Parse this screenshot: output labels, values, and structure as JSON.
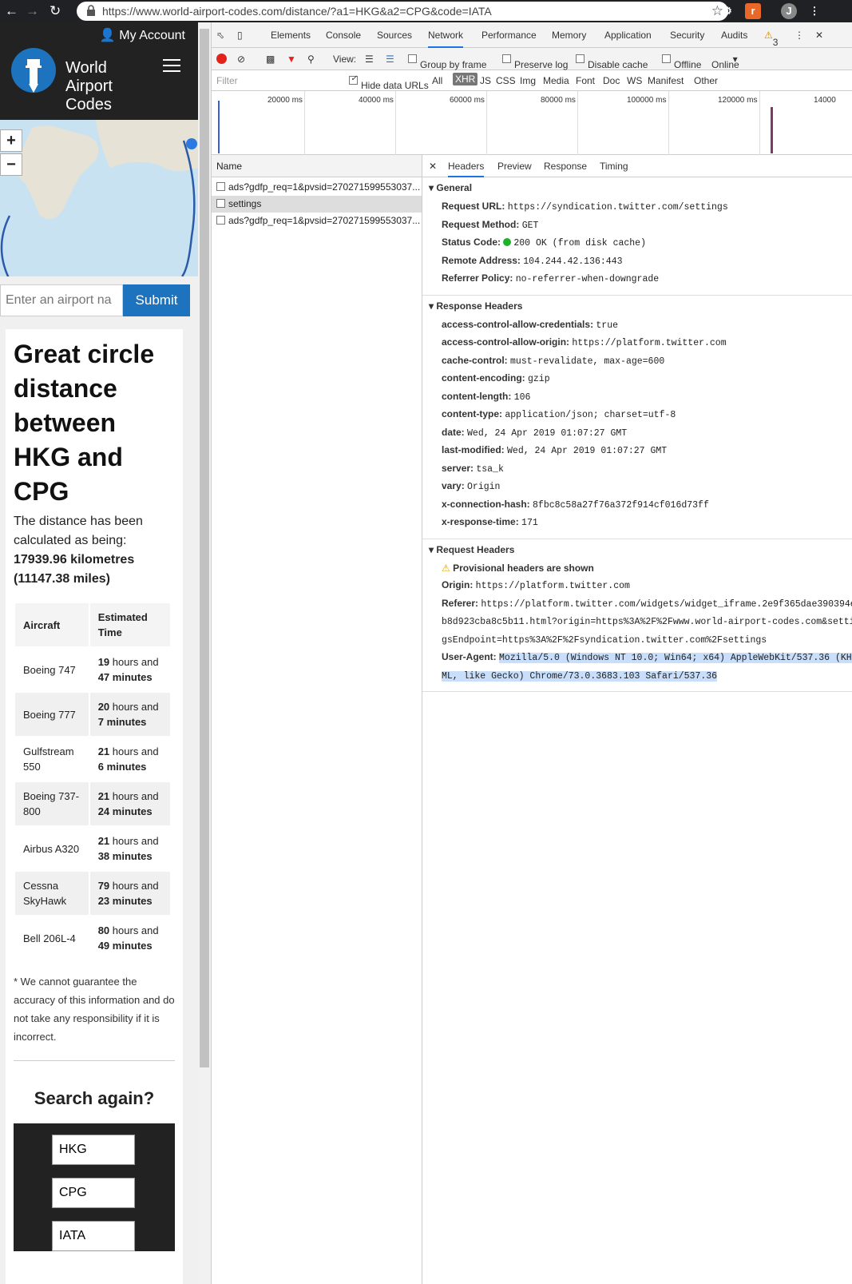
{
  "browser": {
    "url": "https://www.world-airport-codes.com/distance/?a1=HKG&a2=CPG&code=IATA",
    "ext_letter": "J"
  },
  "site": {
    "account": "My Account",
    "brand": [
      "World",
      "Airport",
      "Codes"
    ],
    "search_placeholder": "Enter an airport na",
    "submit": "Submit",
    "heading": "Great circle distance between HKG and CPG",
    "desc": "The distance has been calculated as being:",
    "result_km": "17939.96 kilometres",
    "result_mi": "(11147.38 miles)",
    "table_head": [
      "Aircraft",
      "Estimated Time"
    ],
    "aircraft": [
      {
        "name": "Boeing 747",
        "h": "19",
        "m": "47"
      },
      {
        "name": "Boeing 777",
        "h": "20",
        "m": "7"
      },
      {
        "name": "Gulfstream 550",
        "h": "21",
        "m": "6"
      },
      {
        "name": "Boeing 737-800",
        "h": "21",
        "m": "24"
      },
      {
        "name": "Airbus A320",
        "h": "21",
        "m": "38"
      },
      {
        "name": "Cessna SkyHawk",
        "h": "79",
        "m": "23"
      },
      {
        "name": "Bell 206L-4",
        "h": "80",
        "m": "49"
      }
    ],
    "hours_word": "hours and",
    "minutes_word": "minutes",
    "disclaimer": "* We cannot guarantee the accuracy of this information and do not take any responsibility if it is incorrect.",
    "search_again": "Search again?",
    "again_a1": "HKG",
    "again_a2": "CPG",
    "again_code": "IATA"
  },
  "devtools": {
    "tabs": [
      "Elements",
      "Console",
      "Sources",
      "Network",
      "Performance",
      "Memory",
      "Application",
      "Security",
      "Audits"
    ],
    "warnings": "3",
    "toolbar": {
      "view": "View:",
      "group": "Group by frame",
      "preserve": "Preserve log",
      "disable": "Disable cache",
      "offline": "Offline",
      "throttle": "Online"
    },
    "filter_placeholder": "Filter",
    "hide_data": "Hide data URLs",
    "types": [
      "All",
      "XHR",
      "JS",
      "CSS",
      "Img",
      "Media",
      "Font",
      "Doc",
      "WS",
      "Manifest",
      "Other"
    ],
    "timeline": [
      "20000 ms",
      "40000 ms",
      "60000 ms",
      "80000 ms",
      "100000 ms",
      "120000 ms",
      "14000"
    ],
    "name_col": "Name",
    "requests": [
      "ads?gdfp_req=1&pvsid=270271599553037...",
      "settings",
      "ads?gdfp_req=1&pvsid=270271599553037..."
    ],
    "detail_tabs": [
      "Headers",
      "Preview",
      "Response",
      "Timing"
    ],
    "general_title": "General",
    "general": [
      {
        "k": "Request URL:",
        "v": "https://syndication.twitter.com/settings"
      },
      {
        "k": "Request Method:",
        "v": "GET"
      },
      {
        "k": "Status Code:",
        "v": "200 OK (from disk cache)"
      },
      {
        "k": "Remote Address:",
        "v": "104.244.42.136:443"
      },
      {
        "k": "Referrer Policy:",
        "v": "no-referrer-when-downgrade"
      }
    ],
    "resp_title": "Response Headers",
    "resp": [
      {
        "k": "access-control-allow-credentials:",
        "v": "true"
      },
      {
        "k": "access-control-allow-origin:",
        "v": "https://platform.twitter.com"
      },
      {
        "k": "cache-control:",
        "v": "must-revalidate, max-age=600"
      },
      {
        "k": "content-encoding:",
        "v": "gzip"
      },
      {
        "k": "content-length:",
        "v": "106"
      },
      {
        "k": "content-type:",
        "v": "application/json; charset=utf-8"
      },
      {
        "k": "date:",
        "v": "Wed, 24 Apr 2019 01:07:27 GMT"
      },
      {
        "k": "last-modified:",
        "v": "Wed, 24 Apr 2019 01:07:27 GMT"
      },
      {
        "k": "server:",
        "v": "tsa_k"
      },
      {
        "k": "vary:",
        "v": "Origin"
      },
      {
        "k": "x-connection-hash:",
        "v": "8fbc8c58a27f76a372f914cf016d73ff"
      },
      {
        "k": "x-response-time:",
        "v": "171"
      }
    ],
    "req_title": "Request Headers",
    "provisional": "Provisional headers are shown",
    "origin_k": "Origin:",
    "origin_v": "https://platform.twitter.com",
    "referer_k": "Referer:",
    "referer_v": [
      "https://platform.twitter.com/widgets/widget_iframe.2e9f365dae390394e",
      "b8d923cba8c5b11.html?origin=https%3A%2F%2Fwww.world-airport-codes.com&settin",
      "gsEndpoint=https%3A%2F%2Fsyndication.twitter.com%2Fsettings"
    ],
    "ua_k": "User-Agent:",
    "ua_v": [
      "Mozilla/5.0 (Windows NT 10.0; Win64; x64) AppleWebKit/537.36 (KHT",
      "ML, like Gecko) Chrome/73.0.3683.103 Safari/537.36"
    ]
  }
}
